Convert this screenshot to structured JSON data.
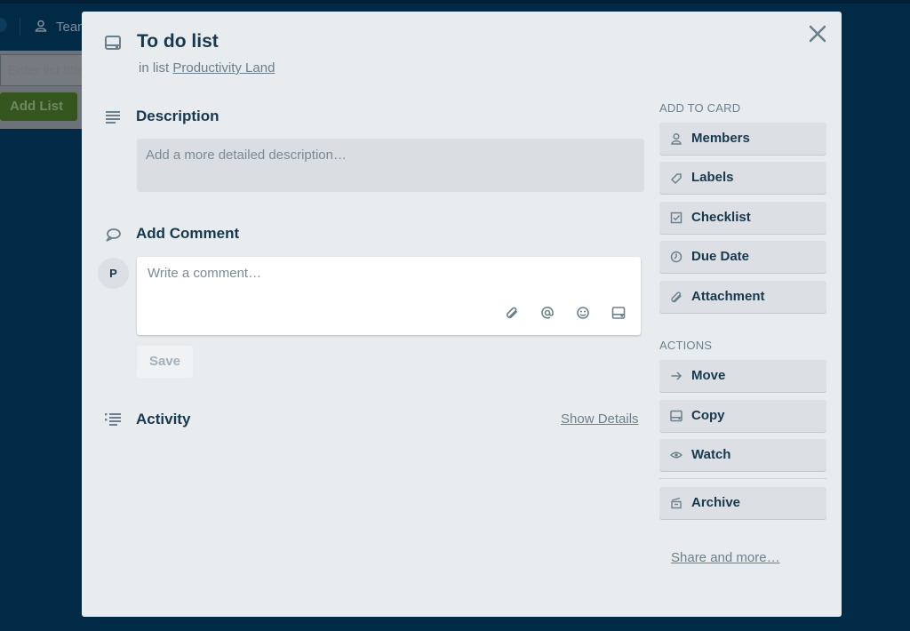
{
  "background": {
    "header": {
      "team_label": "Team"
    },
    "add_list": {
      "input_placeholder": "Enter list title",
      "button_label": "Add List"
    }
  },
  "card": {
    "title": "To do list",
    "in_list_prefix": "in list",
    "list_name": "Productivity Land"
  },
  "description": {
    "title": "Description",
    "placeholder": "Add a more detailed description…"
  },
  "comment": {
    "title": "Add Comment",
    "avatar_initial": "P",
    "placeholder": "Write a comment…",
    "icons": [
      "attachment-icon",
      "mention-icon",
      "emoji-icon",
      "card-icon"
    ],
    "save_label": "Save"
  },
  "activity": {
    "title": "Activity",
    "show_details_label": "Show Details"
  },
  "sidebar": {
    "add_to_card_label": "ADD TO CARD",
    "add_to_card": [
      {
        "label": "Members",
        "icon": "member-icon"
      },
      {
        "label": "Labels",
        "icon": "label-icon"
      },
      {
        "label": "Checklist",
        "icon": "checklist-icon"
      },
      {
        "label": "Due Date",
        "icon": "clock-icon"
      },
      {
        "label": "Attachment",
        "icon": "attachment-icon"
      }
    ],
    "actions_label": "ACTIONS",
    "actions": [
      {
        "label": "Move",
        "icon": "arrow-right-icon"
      },
      {
        "label": "Copy",
        "icon": "card-icon"
      },
      {
        "label": "Watch",
        "icon": "eye-icon"
      },
      {
        "label": "Archive",
        "icon": "archive-icon"
      }
    ],
    "share_label": "Share and more…"
  },
  "colors": {
    "modal_bg": "#e8ecef",
    "heading": "#17394d",
    "muted": "#6b808c",
    "board_bg": "#002a46"
  }
}
